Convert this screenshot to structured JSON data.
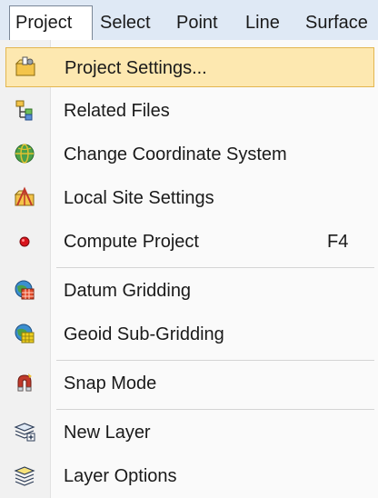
{
  "menubar": {
    "items": [
      {
        "label": "Project"
      },
      {
        "label": "Select"
      },
      {
        "label": "Point"
      },
      {
        "label": "Line"
      },
      {
        "label": "Surface"
      }
    ]
  },
  "project_menu": {
    "items": [
      {
        "label": "Project Settings...",
        "icon": "project-settings-icon",
        "highlighted": true
      },
      {
        "label": "Related Files",
        "icon": "related-files-icon"
      },
      {
        "label": "Change Coordinate System",
        "icon": "globe-icon"
      },
      {
        "label": "Local Site Settings",
        "icon": "local-site-icon"
      },
      {
        "label": "Compute Project",
        "icon": "red-dot-icon",
        "shortcut": "F4"
      },
      {
        "label": "Datum Gridding",
        "icon": "datum-grid-globe-icon"
      },
      {
        "label": "Geoid Sub-Gridding",
        "icon": "geoid-grid-globe-icon"
      },
      {
        "label": "Snap Mode",
        "icon": "snap-magnet-icon"
      },
      {
        "label": "New Layer",
        "icon": "new-layer-icon"
      },
      {
        "label": "Layer Options",
        "icon": "layer-options-icon"
      }
    ]
  },
  "colors": {
    "menubar_bg": "#dfe9f5",
    "highlight_bg": "#fde8b0",
    "highlight_border": "#e3b650"
  }
}
